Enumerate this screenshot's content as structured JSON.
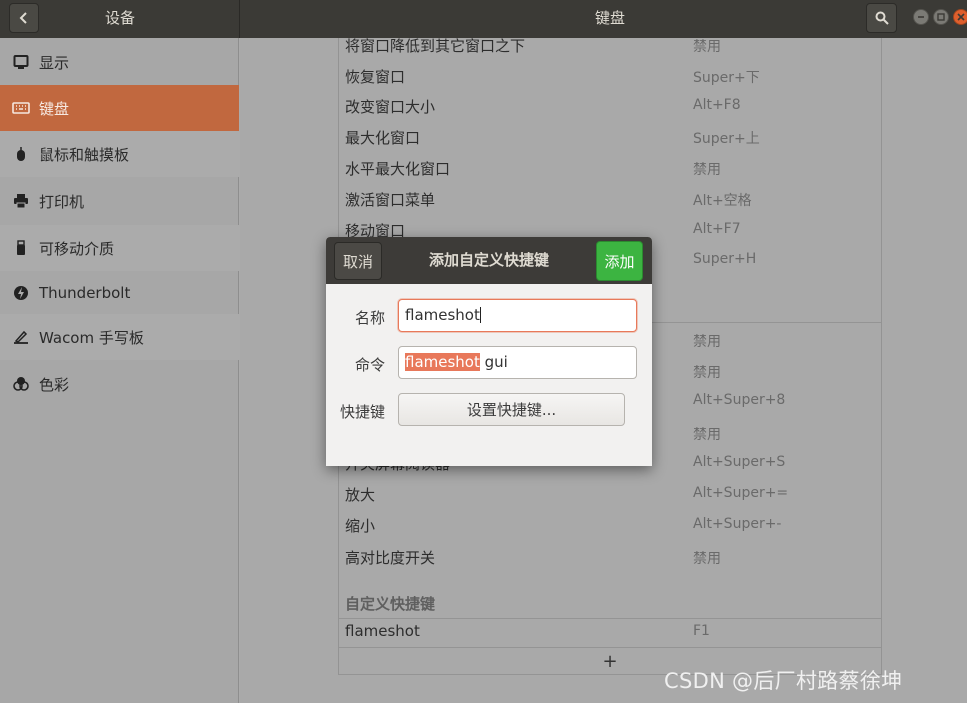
{
  "header": {
    "left_title": "设备",
    "main_title": "键盘"
  },
  "sidebar": {
    "items": [
      {
        "label": "显示",
        "icon": "display-icon"
      },
      {
        "label": "键盘",
        "icon": "keyboard-icon",
        "active": true
      },
      {
        "label": "鼠标和触摸板",
        "icon": "mouse-icon"
      },
      {
        "label": "打印机",
        "icon": "printer-icon"
      },
      {
        "label": "可移动介质",
        "icon": "usb-drive-icon"
      },
      {
        "label": "Thunderbolt",
        "icon": "thunderbolt-icon"
      },
      {
        "label": "Wacom 手写板",
        "icon": "tablet-icon"
      },
      {
        "label": "色彩",
        "icon": "color-icon"
      }
    ]
  },
  "shortcuts": {
    "rows": [
      {
        "name": "将窗口降低到其它窗口之下",
        "value": "禁用"
      },
      {
        "name": "恢复窗口",
        "value": "Super+下"
      },
      {
        "name": "改变窗口大小",
        "value": "Alt+F8"
      },
      {
        "name": "最大化窗口",
        "value": "Super+上"
      },
      {
        "name": "水平最大化窗口",
        "value": "禁用"
      },
      {
        "name": "激活窗口菜单",
        "value": "Alt+空格"
      },
      {
        "name": "移动窗口",
        "value": "Alt+F7"
      },
      {
        "name": "",
        "value": "Super+H"
      },
      {
        "name": "",
        "value": "禁用"
      },
      {
        "name": "",
        "value": "禁用"
      },
      {
        "name": "",
        "value": "Alt+Super+8"
      },
      {
        "name": "",
        "value": "禁用"
      },
      {
        "name": "开关屏幕阅读器",
        "value": "Alt+Super+S"
      },
      {
        "name": "放大",
        "value": "Alt+Super+="
      },
      {
        "name": "缩小",
        "value": "Alt+Super+-"
      },
      {
        "name": "高对比度开关",
        "value": "禁用"
      }
    ],
    "custom_section_title": "自定义快捷键",
    "custom_rows": [
      {
        "name": "flameshot",
        "value": "F1"
      }
    ],
    "add_symbol": "+"
  },
  "dialog": {
    "title": "添加自定义快捷键",
    "cancel_label": "取消",
    "add_label": "添加",
    "name_label": "名称",
    "name_value": "flameshot",
    "command_label": "命令",
    "command_selected": "flameshot",
    "command_rest": " gui",
    "shortcut_label": "快捷键",
    "shortcut_button": "设置快捷键..."
  },
  "watermark": "CSDN @后厂村路蔡徐坤",
  "colors": {
    "accent": "#e8785a",
    "sidebar_active": "#c1683f",
    "add_button": "#3cb441",
    "headerbar": "#3b3a36"
  }
}
